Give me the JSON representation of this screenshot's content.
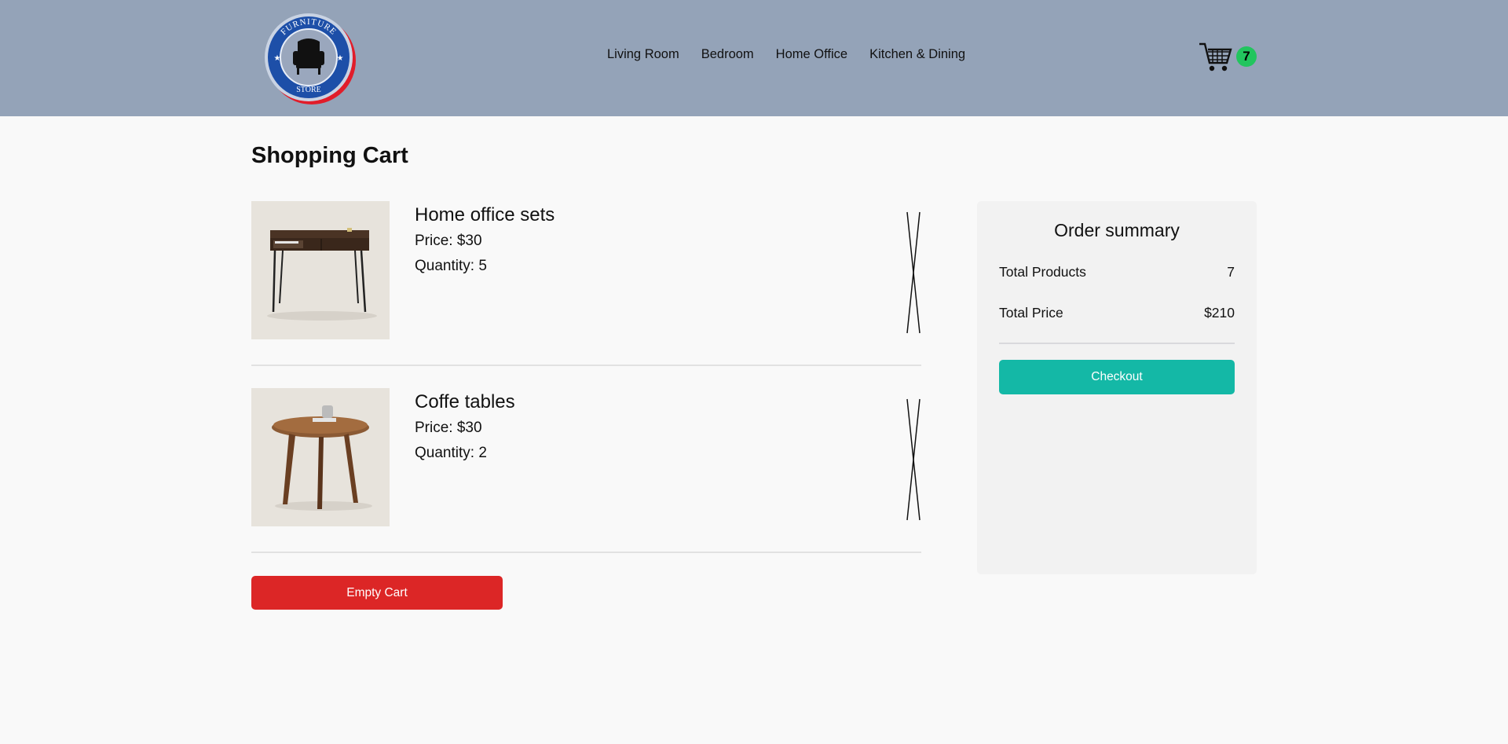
{
  "header": {
    "logo_text_top": "FURNITURE",
    "logo_text_bottom": "STORE",
    "nav": [
      "Living Room",
      "Bedroom",
      "Home Office",
      "Kitchen & Dining"
    ],
    "cart_count": "7",
    "cart_icon": "shopping-cart-icon"
  },
  "page": {
    "title": "Shopping Cart"
  },
  "items": [
    {
      "name": "Home office sets",
      "price": "Price: $30",
      "quantity": "Quantity: 5",
      "image": "desk-image"
    },
    {
      "name": "Coffe tables",
      "price": "Price: $30",
      "quantity": "Quantity: 2",
      "image": "coffee-table-image"
    }
  ],
  "actions": {
    "empty_cart": "Empty Cart"
  },
  "summary": {
    "title": "Order summary",
    "total_products_label": "Total Products",
    "total_products_value": "7",
    "total_price_label": "Total Price",
    "total_price_value": "$210",
    "checkout": "Checkout"
  },
  "colors": {
    "header_bg": "#94a3b8",
    "badge": "#22c55e",
    "danger": "#dc2626",
    "accent": "#14b8a6",
    "logo_blue": "#1d4fa8",
    "logo_red": "#e11d2a"
  }
}
